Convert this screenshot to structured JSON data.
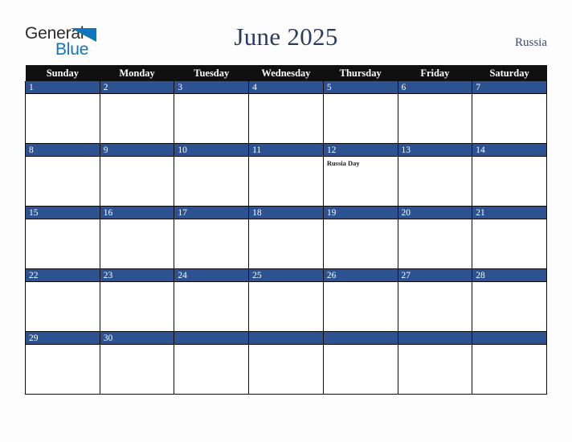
{
  "logo": {
    "word_one": "General",
    "word_two": "Blue",
    "triangle_color": "#1175bd",
    "text_color": "#2b2b2b"
  },
  "header": {
    "title": "June 2025",
    "country": "Russia",
    "title_color": "#2a3b60"
  },
  "colors": {
    "header_row_bg": "#101010",
    "date_band_bg": "#2d5291",
    "cell_bg": "#ffffff",
    "page_bg": "#fdfdfd",
    "grid_line": "#0b0b0b"
  },
  "calendar": {
    "month": "June",
    "year": "2025",
    "weekday_headers": [
      "Sunday",
      "Monday",
      "Tuesday",
      "Wednesday",
      "Thursday",
      "Friday",
      "Saturday"
    ],
    "weeks": [
      [
        {
          "day": "1",
          "events": []
        },
        {
          "day": "2",
          "events": []
        },
        {
          "day": "3",
          "events": []
        },
        {
          "day": "4",
          "events": []
        },
        {
          "day": "5",
          "events": []
        },
        {
          "day": "6",
          "events": []
        },
        {
          "day": "7",
          "events": []
        }
      ],
      [
        {
          "day": "8",
          "events": []
        },
        {
          "day": "9",
          "events": []
        },
        {
          "day": "10",
          "events": []
        },
        {
          "day": "11",
          "events": []
        },
        {
          "day": "12",
          "events": [
            "Russia Day"
          ]
        },
        {
          "day": "13",
          "events": []
        },
        {
          "day": "14",
          "events": []
        }
      ],
      [
        {
          "day": "15",
          "events": []
        },
        {
          "day": "16",
          "events": []
        },
        {
          "day": "17",
          "events": []
        },
        {
          "day": "18",
          "events": []
        },
        {
          "day": "19",
          "events": []
        },
        {
          "day": "20",
          "events": []
        },
        {
          "day": "21",
          "events": []
        }
      ],
      [
        {
          "day": "22",
          "events": []
        },
        {
          "day": "23",
          "events": []
        },
        {
          "day": "24",
          "events": []
        },
        {
          "day": "25",
          "events": []
        },
        {
          "day": "26",
          "events": []
        },
        {
          "day": "27",
          "events": []
        },
        {
          "day": "28",
          "events": []
        }
      ],
      [
        {
          "day": "29",
          "events": []
        },
        {
          "day": "30",
          "events": []
        },
        {
          "day": "",
          "events": []
        },
        {
          "day": "",
          "events": []
        },
        {
          "day": "",
          "events": []
        },
        {
          "day": "",
          "events": []
        },
        {
          "day": "",
          "events": []
        }
      ]
    ]
  }
}
